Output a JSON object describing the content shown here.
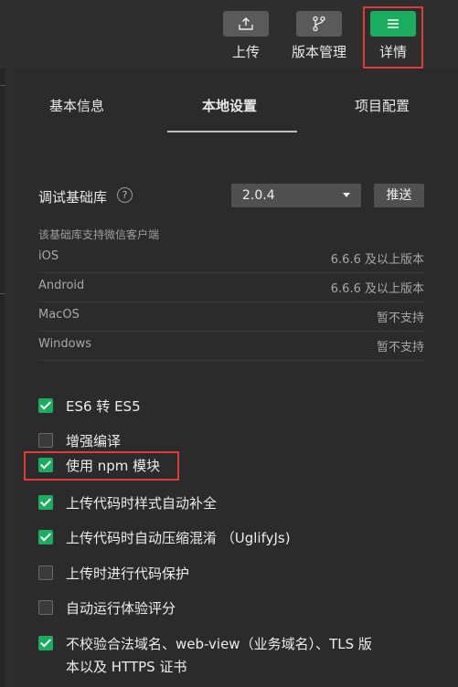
{
  "toolbar": {
    "upload_label": "上传",
    "version_label": "版本管理",
    "detail_label": "详情"
  },
  "tabs": [
    {
      "label": "基本信息"
    },
    {
      "label": "本地设置"
    },
    {
      "label": "项目配置"
    }
  ],
  "library": {
    "label": "调试基础库",
    "help": "?",
    "version": "2.0.4",
    "push_label": "推送"
  },
  "support": {
    "title": "该基础库支持微信客户端",
    "rows": [
      {
        "platform": "iOS",
        "value": "6.6.6 及以上版本"
      },
      {
        "platform": "Android",
        "value": "6.6.6 及以上版本"
      },
      {
        "platform": "MacOS",
        "value": "暂不支持"
      },
      {
        "platform": "Windows",
        "value": "暂不支持"
      }
    ]
  },
  "options": [
    {
      "label": "ES6 转 ES5",
      "checked": true
    },
    {
      "label": "增强编译",
      "checked": false
    },
    {
      "label": "使用 npm 模块",
      "checked": true
    },
    {
      "label": "上传代码时样式自动补全",
      "checked": true
    },
    {
      "label": "上传代码时自动压缩混淆 （UglifyJs)",
      "checked": true
    },
    {
      "label": "上传时进行代码保护",
      "checked": false
    },
    {
      "label": "自动运行体验评分",
      "checked": false
    },
    {
      "label": "不校验合法域名、web-view（业务域名）、TLS 版",
      "label_line2": "本以及 HTTPS 证书",
      "checked": true
    }
  ],
  "colors": {
    "accent_green": "#1aad5f",
    "highlight_red": "#e03a3a",
    "background": "#2e2e2e"
  }
}
